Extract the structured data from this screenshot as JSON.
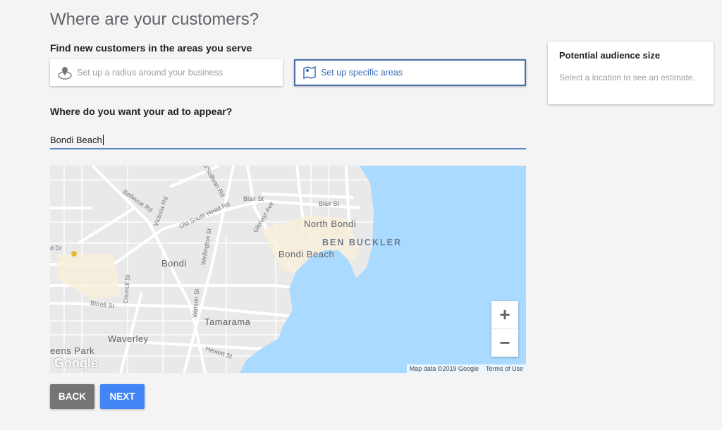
{
  "page": {
    "title": "Where are your customers?",
    "find_heading": "Find new customers in the areas you serve",
    "where_heading": "Where do you want your ad to appear?"
  },
  "options": [
    {
      "label": "Set up a radius around your business",
      "icon": "radius-pin-icon",
      "selected": false
    },
    {
      "label": "Set up specific areas",
      "icon": "map-icon",
      "selected": true
    }
  ],
  "location_input": {
    "value": "Bondi Beach"
  },
  "map": {
    "places": [
      "North Bondi",
      "BEN BUCKLER",
      "Bondi Beach",
      "Bondi",
      "Tamarama",
      "Waverley",
      "eens Park"
    ],
    "streets": [
      "O'Sullivan Rd",
      "Bellevue Rd",
      "Victoria Rd",
      "Old South Head Rd",
      "Blair St",
      "Blair St",
      "Glenayr Ave",
      "Wellington St",
      "d Dr",
      "Council St",
      "Birrell St",
      "Watson St",
      "Hewett St"
    ],
    "zoom_in": "+",
    "zoom_out": "−",
    "attribution": "Map data ©2019 Google",
    "terms": "Terms of Use",
    "logo": "Google"
  },
  "buttons": {
    "back": "BACK",
    "next": "NEXT"
  },
  "audience": {
    "title": "Potential audience size",
    "desc": "Select a location to see an estimate."
  },
  "colors": {
    "accent": "#4285f4",
    "selected_border": "#4a6fa5",
    "sea": "#aadaff"
  }
}
